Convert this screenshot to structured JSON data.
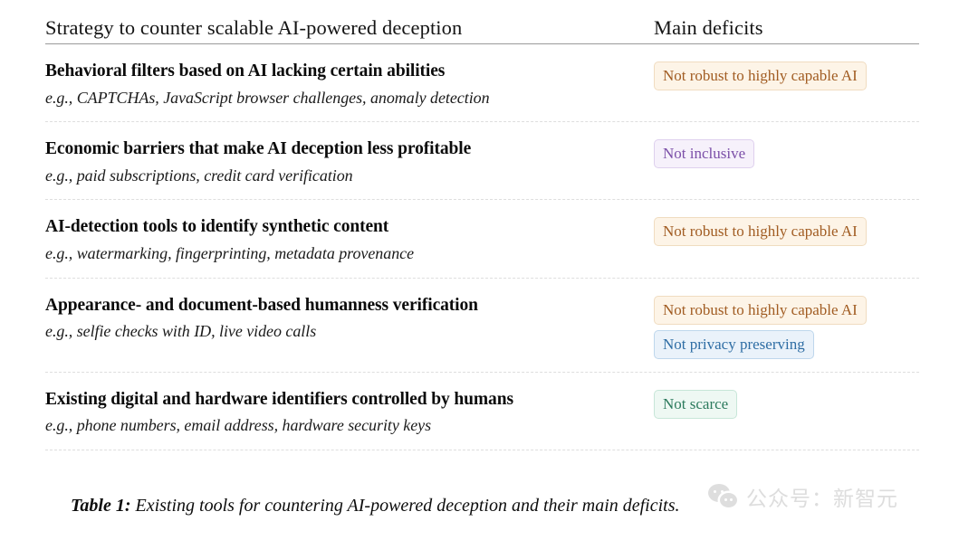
{
  "table": {
    "columns": {
      "strategy": "Strategy to counter scalable AI-powered deception",
      "deficits": "Main deficits"
    },
    "rows": [
      {
        "title": "Behavioral filters based on AI lacking certain abilities",
        "example": "e.g., CAPTCHAs, JavaScript browser challenges, anomaly detection",
        "deficits": [
          {
            "label": "Not robust to highly capable AI",
            "color_name": "orange",
            "text_color": "#a15c22",
            "bg_color": "#fdf4e7",
            "border_color": "#f0dcc0"
          }
        ]
      },
      {
        "title": "Economic barriers that make AI deception less profitable",
        "example": "e.g., paid subscriptions, credit card verification",
        "deficits": [
          {
            "label": "Not inclusive",
            "color_name": "purple",
            "text_color": "#7b4fa8",
            "bg_color": "#f6f1fb",
            "border_color": "#ded0ee"
          }
        ]
      },
      {
        "title": "AI-detection tools to identify synthetic content",
        "example": "e.g., watermarking, fingerprinting, metadata provenance",
        "deficits": [
          {
            "label": "Not robust to highly capable AI",
            "color_name": "orange",
            "text_color": "#a15c22",
            "bg_color": "#fdf4e7",
            "border_color": "#f0dcc0"
          }
        ]
      },
      {
        "title": "Appearance- and document-based humanness verification",
        "example": "e.g., selfie checks with ID, live video calls",
        "deficits": [
          {
            "label": "Not robust to highly capable AI",
            "color_name": "orange",
            "text_color": "#a15c22",
            "bg_color": "#fdf4e7",
            "border_color": "#f0dcc0"
          },
          {
            "label": "Not privacy preserving",
            "color_name": "blue",
            "text_color": "#2e6da4",
            "bg_color": "#eaf2fa",
            "border_color": "#bed7ec"
          }
        ]
      },
      {
        "title": "Existing digital and hardware identifiers controlled by humans",
        "example": "e.g., phone numbers, email address, hardware security keys",
        "deficits": [
          {
            "label": "Not scarce",
            "color_name": "green",
            "text_color": "#2c7a5d",
            "bg_color": "#eef8f3",
            "border_color": "#c7e6d8"
          }
        ]
      }
    ]
  },
  "caption": {
    "label": "Table 1:",
    "text": " Existing tools for countering AI-powered deception and their main deficits."
  },
  "watermark": {
    "icon": "wechat-logo-icon",
    "text": "公众号：新智元",
    "color": "#b4b4b4"
  }
}
